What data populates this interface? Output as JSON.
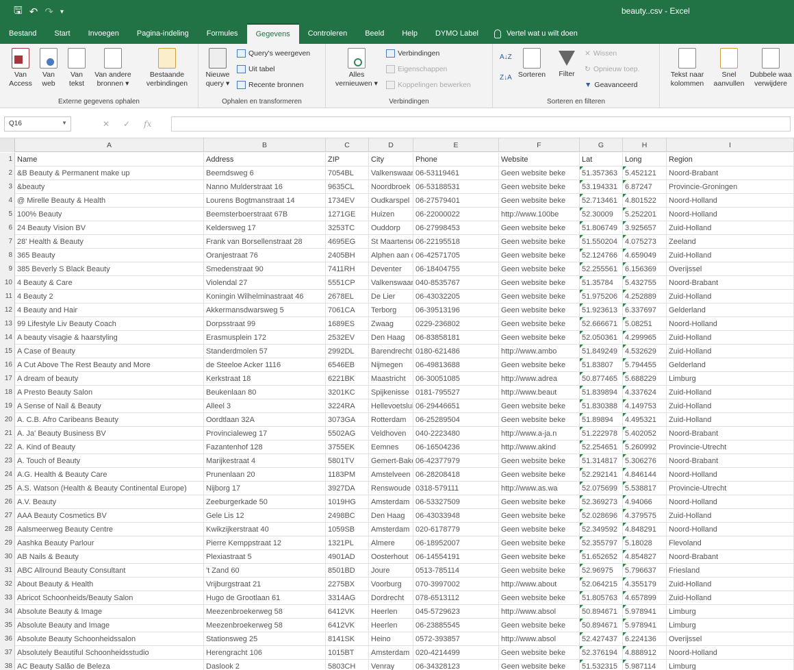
{
  "window": {
    "title": "beauty..csv - Excel"
  },
  "qat": {
    "save_glyph": "🖫",
    "undo_glyph": "↶",
    "redo_glyph": "↷",
    "customize_glyph": "▾"
  },
  "tabs": [
    "Bestand",
    "Start",
    "Invoegen",
    "Pagina-indeling",
    "Formules",
    "Gegevens",
    "Controleren",
    "Beeld",
    "Help",
    "DYMO Label"
  ],
  "active_tab": "Gegevens",
  "tell_me": "Vertel wat u wilt doen",
  "ribbon": {
    "external": {
      "label": "Externe gegevens ophalen",
      "buttons": [
        {
          "line1": "Van",
          "line2": "Access"
        },
        {
          "line1": "Van",
          "line2": "web"
        },
        {
          "line1": "Van",
          "line2": "tekst"
        },
        {
          "line1": "Van andere",
          "line2": "bronnen ▾"
        },
        {
          "line1": "Bestaande",
          "line2": "verbindingen"
        }
      ]
    },
    "transform": {
      "label": "Ophalen en transformeren",
      "new_query": {
        "line1": "Nieuwe",
        "line2": "query ▾"
      },
      "small": [
        "Query's weergeven",
        "Uit tabel",
        "Recente bronnen"
      ]
    },
    "connections": {
      "label": "Verbindingen",
      "refresh": {
        "line1": "Alles",
        "line2": "vernieuwen ▾"
      },
      "small": [
        "Verbindingen",
        "Eigenschappen",
        "Koppelingen bewerken"
      ]
    },
    "sort": {
      "label": "Sorteren en filteren",
      "sort": "Sorteren",
      "filter": "Filter",
      "small": [
        "Wissen",
        "Opnieuw toep.",
        "Geavanceerd"
      ]
    },
    "tools": {
      "text_to_columns": {
        "line1": "Tekst naar",
        "line2": "kolommen"
      },
      "flash_fill": {
        "line1": "Snel",
        "line2": "aanvullen"
      },
      "remove_dupes": {
        "line1": "Dubbele waa",
        "line2": "verwijdere"
      }
    }
  },
  "formula_bar": {
    "name_box": "Q16",
    "cancel_glyph": "✕",
    "enter_glyph": "✓",
    "fx_label": "fx",
    "value": ""
  },
  "columns": [
    "A",
    "B",
    "C",
    "D",
    "E",
    "F",
    "G",
    "H",
    "I"
  ],
  "rows": [
    [
      "Name",
      "Address",
      "ZIP",
      "City",
      "Phone",
      "Website",
      "Lat",
      "Long",
      "Region"
    ],
    [
      "&B Beauty & Permanent make up",
      "Beemdsweg 6",
      "7054BL",
      "Valkenswaard",
      "06-53119461",
      "Geen website beke",
      "51.357363",
      "5.452121",
      "Noord-Brabant"
    ],
    [
      "&beauty",
      "Nanno Mulderstraat 16",
      "9635CL",
      "Noordbroek",
      "06-53188531",
      "Geen website beke",
      "53.194331",
      "6.87247",
      "Provincie-Groningen"
    ],
    [
      "@ Mirelle Beauty & Health",
      "Lourens Bogtmanstraat 14",
      "1734EV",
      "Oudkarspel",
      "06-27579401",
      "Geen website beke",
      "52.713461",
      "4.801522",
      "Noord-Holland"
    ],
    [
      "100% Beauty",
      "Beemsterboerstraat 67B",
      "1271GE",
      "Huizen",
      "06-22000022",
      "http://www.100be",
      "52.30009",
      "5.252201",
      "Noord-Holland"
    ],
    [
      "24 Beauty Vision BV",
      "Keldersweg 17",
      "3253TC",
      "Ouddorp",
      "06-27998453",
      "Geen website beke",
      "51.806749",
      "3.925657",
      "Zuid-Holland"
    ],
    [
      "28' Health & Beauty",
      "Frank van Borsellenstraat 28",
      "4695EG",
      "St Maartensdijk",
      "06-22195518",
      "Geen website beke",
      "51.550204",
      "4.075273",
      "Zeeland"
    ],
    [
      "365 Beauty",
      "Oranjestraat 76",
      "2405BH",
      "Alphen aan den Rijn",
      "06-42571705",
      "Geen website beke",
      "52.124766",
      "4.659049",
      "Zuid-Holland"
    ],
    [
      "385 Beverly S Black Beauty",
      "Smedenstraat 90",
      "7411RH",
      "Deventer",
      "06-18404755",
      "Geen website beke",
      "52.255561",
      "6.156369",
      "Overijssel"
    ],
    [
      "4 Beauty & Care",
      "Violendal 27",
      "5551CP",
      "Valkenswaard",
      "040-8535767",
      "Geen website beke",
      "51.35784",
      "5.432755",
      "Noord-Brabant"
    ],
    [
      "4 Beauty 2",
      "Koningin Wilhelminastraat 46",
      "2678EL",
      "De Lier",
      "06-43032205",
      "Geen website beke",
      "51.975206",
      "4.252889",
      "Zuid-Holland"
    ],
    [
      "4 Beauty and Hair",
      "Akkermansdwarsweg 5",
      "7061CA",
      "Terborg",
      "06-39513196",
      "Geen website beke",
      "51.923613",
      "6.337697",
      "Gelderland"
    ],
    [
      "99 Lifestyle Liv Beauty Coach",
      "Dorpsstraat 99",
      "1689ES",
      "Zwaag",
      "0229-236802",
      "Geen website beke",
      "52.666671",
      "5.08251",
      "Noord-Holland"
    ],
    [
      "A beauty visagie & haarstyling",
      "Erasmusplein 172",
      "2532EV",
      "Den Haag",
      "06-83858181",
      "Geen website beke",
      "52.050361",
      "4.299965",
      "Zuid-Holland"
    ],
    [
      "A Case of Beauty",
      "Standerdmolen 57",
      "2992DL",
      "Barendrecht",
      "0180-621486",
      "http://www.ambo",
      "51.849249",
      "4.532629",
      "Zuid-Holland"
    ],
    [
      "A Cut Above The Rest Beauty and More",
      "de Steeloe Acker 1116",
      "6546EB",
      "Nijmegen",
      "06-49813688",
      "Geen website beke",
      "51.83807",
      "5.794455",
      "Gelderland"
    ],
    [
      "A dream of beauty",
      "Kerkstraat 18",
      "6221BK",
      "Maastricht",
      "06-30051085",
      "http://www.adrea",
      "50.877465",
      "5.688229",
      "Limburg"
    ],
    [
      "A Presto Beauty Salon",
      "Beukenlaan 80",
      "3201KC",
      "Spijkenisse",
      "0181-795527",
      "http://www.beaut",
      "51.839894",
      "4.337624",
      "Zuid-Holland"
    ],
    [
      "A Sense of Nail & Beauty",
      "Alleel 3",
      "3224RA",
      "Hellevoetsluis",
      "06-29446651",
      "Geen website beke",
      "51.830388",
      "4.149753",
      "Zuid-Holland"
    ],
    [
      "A. C.B. Afro Caribeans Beauty",
      "Oordtlaan 32A",
      "3073GA",
      "Rotterdam",
      "06-25289504",
      "Geen website beke",
      "51.89894",
      "4.495321",
      "Zuid-Holland"
    ],
    [
      "A. Ja' Beauty Business BV",
      "Provincialeweg 17",
      "5502AG",
      "Veldhoven",
      "040-2223480",
      "http://www.a-ja.n",
      "51.222978",
      "5.402052",
      "Noord-Brabant"
    ],
    [
      "A. Kind of Beauty",
      "Fazantenhof 128",
      "3755EK",
      "Eemnes",
      "06-16504236",
      "http://www.akind",
      "52.254651",
      "5.260992",
      "Provincie-Utrecht"
    ],
    [
      "A. Touch of Beauty",
      "Marijkestraat 4",
      "5801TV",
      "Gemert-Bakel",
      "06-42377979",
      "Geen website beke",
      "51.314817",
      "5.306276",
      "Noord-Brabant"
    ],
    [
      "A.G. Health & Beauty Care",
      "Prunenlaan 20",
      "1183PM",
      "Amstelveen",
      "06-28208418",
      "Geen website beke",
      "52.292141",
      "4.846144",
      "Noord-Holland"
    ],
    [
      "A.S. Watson (Health & Beauty Continental Europe)",
      "Nijborg 17",
      "3927DA",
      "Renswoude",
      "0318-579111",
      "http://www.as.wa",
      "52.075699",
      "5.538817",
      "Provincie-Utrecht"
    ],
    [
      "A.V. Beauty",
      "Zeeburgerkade 50",
      "1019HG",
      "Amsterdam",
      "06-53327509",
      "Geen website beke",
      "52.369273",
      "4.94066",
      "Noord-Holland"
    ],
    [
      "AAA Beauty Cosmetics BV",
      "Gele Lis 12",
      "2498BC",
      "Den Haag",
      "06-43033948",
      "Geen website beke",
      "52.028696",
      "4.379575",
      "Zuid-Holland"
    ],
    [
      "Aalsmeerweg Beauty Centre",
      "Kwikzijkerstraat 40",
      "1059SB",
      "Amsterdam",
      "020-6178779",
      "Geen website beke",
      "52.349592",
      "4.848291",
      "Noord-Holland"
    ],
    [
      "Aashka Beauty Parlour",
      "Pierre Kemppstraat 12",
      "1321PL",
      "Almere",
      "06-18952007",
      "Geen website beke",
      "52.355797",
      "5.18028",
      "Flevoland"
    ],
    [
      "AB Nails & Beauty",
      "Plexiastraat 5",
      "4901AD",
      "Oosterhout",
      "06-14554191",
      "Geen website beke",
      "51.652652",
      "4.854827",
      "Noord-Brabant"
    ],
    [
      "ABC Allround Beauty Consultant",
      "'t Zand 60",
      "8501BD",
      "Joure",
      "0513-785114",
      "Geen website beke",
      "52.96975",
      "5.796637",
      "Friesland"
    ],
    [
      "About Beauty & Health",
      "Vrijburgstraat 21",
      "2275BX",
      "Voorburg",
      "070-3997002",
      "http://www.about",
      "52.064215",
      "4.355179",
      "Zuid-Holland"
    ],
    [
      "Abricot Schoonheids/Beauty Salon",
      "Hugo de Grootlaan 61",
      "3314AG",
      "Dordrecht",
      "078-6513112",
      "Geen website beke",
      "51.805763",
      "4.657899",
      "Zuid-Holland"
    ],
    [
      "Absolute Beauty & Image",
      "Meezenbroekerweg 58",
      "6412VK",
      "Heerlen",
      "045-5729623",
      "http://www.absol",
      "50.894671",
      "5.978941",
      "Limburg"
    ],
    [
      "Absolute Beauty and Image",
      "Meezenbroekerweg 58",
      "6412VK",
      "Heerlen",
      "06-23885545",
      "Geen website beke",
      "50.894671",
      "5.978941",
      "Limburg"
    ],
    [
      "Absolute Beauty Schoonheidssalon",
      "Stationsweg 25",
      "8141SK",
      "Heino",
      "0572-393857",
      "http://www.absol",
      "52.427437",
      "6.224136",
      "Overijssel"
    ],
    [
      "Absolutely Beautiful Schoonheidsstudio",
      "Herengracht 106",
      "1015BT",
      "Amsterdam",
      "020-4214499",
      "Geen website beke",
      "52.376194",
      "4.888912",
      "Noord-Holland"
    ],
    [
      "AC Beauty Salão de Beleza",
      "Daslook 2",
      "5803CH",
      "Venray",
      "06-34328123",
      "Geen website beke",
      "51.532315",
      "5.987114",
      "Limburg"
    ]
  ]
}
